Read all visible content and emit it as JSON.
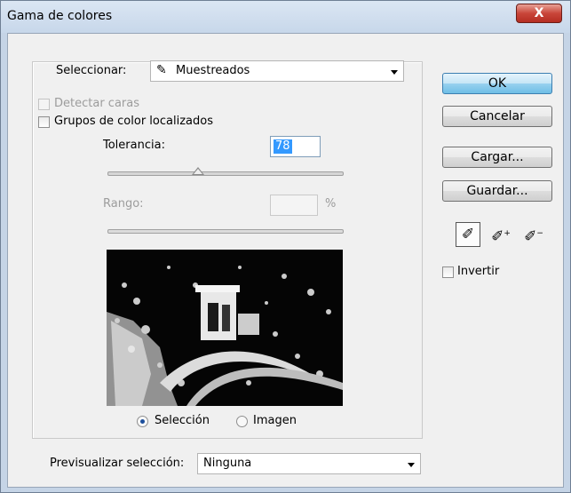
{
  "window": {
    "title": "Gama de colores",
    "close_glyph": "X"
  },
  "select_row": {
    "label": "Seleccionar:",
    "value": "Muestreados",
    "icon": "eyedropper-icon"
  },
  "options": {
    "detect_faces": "Detectar caras",
    "localized_clusters": "Grupos de color localizados"
  },
  "tolerance": {
    "label": "Tolerancia:",
    "value": "78"
  },
  "range": {
    "label": "Rango:",
    "value": "",
    "unit": "%"
  },
  "preview": {
    "image": "black-and-white selection mask"
  },
  "view_mode": {
    "selection": "Selección",
    "image": "Imagen"
  },
  "preview_select": {
    "label": "Previsualizar selección:",
    "value": "Ninguna"
  },
  "buttons": {
    "ok": "OK",
    "cancel": "Cancelar",
    "load": "Cargar...",
    "save": "Guardar..."
  },
  "tools": [
    "eyedropper-icon",
    "eyedropper-plus-icon",
    "eyedropper-minus-icon"
  ],
  "invert": "Invertir",
  "colors": {
    "title_bg": "#c7d7ea",
    "close_red": "#c9463a",
    "selection_blue": "#3399ff"
  }
}
